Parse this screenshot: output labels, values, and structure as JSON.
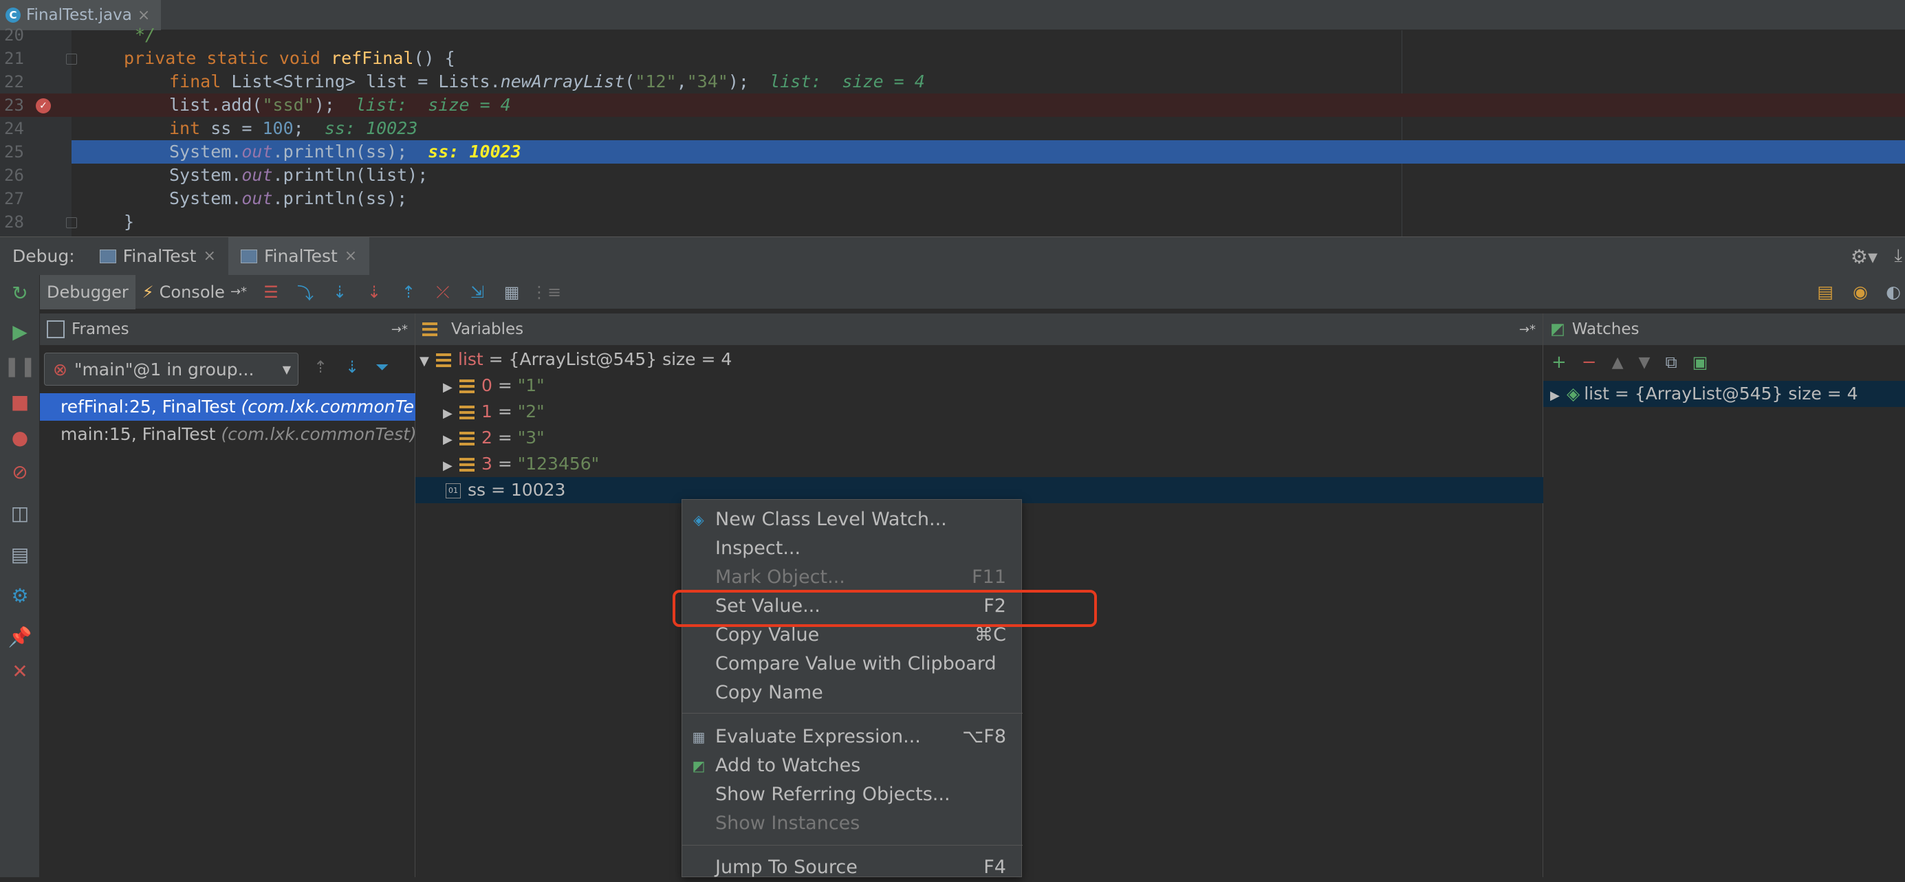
{
  "file_tab": {
    "name": "FinalTest.java",
    "close": "×"
  },
  "editor": {
    "lines": [
      {
        "num": "20"
      },
      {
        "num": "21"
      },
      {
        "num": "22"
      },
      {
        "num": "23"
      },
      {
        "num": "24"
      },
      {
        "num": "25"
      },
      {
        "num": "26"
      },
      {
        "num": "27"
      },
      {
        "num": "28"
      }
    ],
    "l20": "*/",
    "l21_kw": "private static void ",
    "l21_fn": "refFinal",
    "l21_rest": "() {",
    "l22_a": "final ",
    "l22_b": "List<String> list = Lists.",
    "l22_c": "newArrayList",
    "l22_d": "(",
    "l22_s1": "\"12\"",
    "l22_comma": ",",
    "l22_s2": "\"34\"",
    "l22_e": ");",
    "l22_hint": "list:  size = 4",
    "l23_a": "list.add(",
    "l23_s": "\"ssd\"",
    "l23_b": ");",
    "l23_hint": "list:  size = 4",
    "l24_kw": "int ",
    "l24_a": "ss = ",
    "l24_n": "100",
    "l24_b": ";",
    "l24_hint": "ss: 10023",
    "l25_a": "System.",
    "l25_f": "out",
    "l25_b": ".println(ss);",
    "l25_hint": "ss: 10023",
    "l26_a": "System.",
    "l26_f": "out",
    "l26_b": ".println(list);",
    "l27_a": "System.",
    "l27_f": "out",
    "l27_b": ".println(ss);",
    "l28": "}"
  },
  "debug": {
    "label": "Debug:",
    "tabs": [
      {
        "label": "FinalTest"
      },
      {
        "label": "FinalTest"
      }
    ],
    "debugger_tab": "Debugger",
    "console_tab": "Console"
  },
  "frames": {
    "title": "Frames",
    "thread": "\"main\"@1 in group...",
    "items": [
      {
        "method": "refFinal:25, FinalTest ",
        "pkg": "(com.lxk.commonTe"
      },
      {
        "method": "main:15, FinalTest ",
        "pkg": "(com.lxk.commonTest)"
      }
    ]
  },
  "variables": {
    "title": "Variables",
    "list_name": "list",
    "list_value": " = {ArrayList@545}  size = 4",
    "items": [
      {
        "idx": "0",
        "eq": " = ",
        "val": "\"1\""
      },
      {
        "idx": "1",
        "eq": " = ",
        "val": "\"2\""
      },
      {
        "idx": "2",
        "eq": " = ",
        "val": "\"3\""
      },
      {
        "idx": "3",
        "eq": " = ",
        "val": "\"123456\""
      }
    ],
    "ss": "ss = 10023",
    "ss_icon": "01"
  },
  "watches": {
    "title": "Watches",
    "item": "list = {ArrayList@545}  size = 4"
  },
  "context_menu": {
    "items": [
      {
        "label": "New Class Level Watch...",
        "shortcut": ""
      },
      {
        "label": "Inspect...",
        "shortcut": ""
      },
      {
        "label": "Mark Object...",
        "shortcut": "F11"
      },
      {
        "label": "Set Value...",
        "shortcut": "F2"
      },
      {
        "label": "Copy Value",
        "shortcut": "⌘C"
      },
      {
        "label": "Compare Value with Clipboard",
        "shortcut": ""
      },
      {
        "label": "Copy Name",
        "shortcut": ""
      },
      {
        "label": "Evaluate Expression...",
        "shortcut": "⌥F8"
      },
      {
        "label": "Add to Watches",
        "shortcut": ""
      },
      {
        "label": "Show Referring Objects...",
        "shortcut": ""
      },
      {
        "label": "Show Instances",
        "shortcut": ""
      },
      {
        "label": "Jump To Source",
        "shortcut": "F4"
      }
    ]
  },
  "colors": {
    "highlight": "#e53a1e",
    "selection": "#2f65ca"
  }
}
